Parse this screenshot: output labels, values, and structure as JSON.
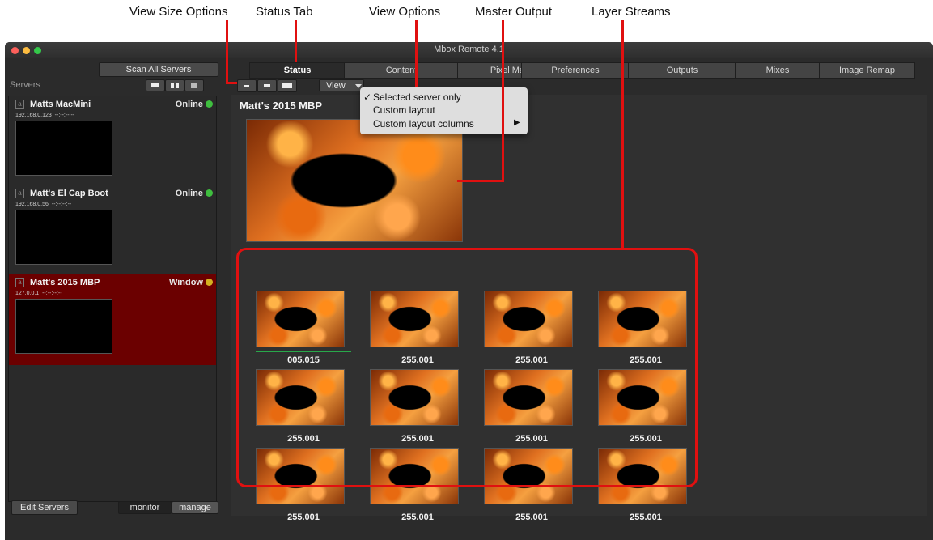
{
  "callouts": {
    "view_size": "View Size Options",
    "status_tab": "Status Tab",
    "view_options": "View Options",
    "master_output": "Master Output",
    "layer_streams": "Layer Streams"
  },
  "window": {
    "title": "Mbox Remote 4.1"
  },
  "toolbar": {
    "scan_all": "Scan All Servers",
    "servers_label": "Servers",
    "view_button": "View"
  },
  "tabs": [
    {
      "label": "Status",
      "active": true
    },
    {
      "label": "Content"
    },
    {
      "label": "Pixel Map"
    },
    {
      "label": "Preferences"
    },
    {
      "label": "Outputs"
    },
    {
      "label": "Mixes"
    },
    {
      "label": "Image Remap"
    }
  ],
  "servers": [
    {
      "name": "Matts MacMini",
      "ip": "192.168.0.123",
      "ip_extra": "--:--:--:--",
      "status": "Online",
      "status_color": "#3fbf3f"
    },
    {
      "name": "Matt's El Cap Boot",
      "ip": "192.168.0.56",
      "ip_extra": "--:--:--:--",
      "status": "Online",
      "status_color": "#3fbf3f"
    },
    {
      "name": "Matt's 2015 MBP",
      "ip": "127.0.0.1",
      "ip_extra": "--:--:--:--",
      "status": "Window",
      "status_color": "#d4b020",
      "selected": true
    }
  ],
  "view_menu": {
    "items": [
      "Selected server only",
      "Custom layout",
      "Custom layout columns"
    ],
    "checked": "Selected server only"
  },
  "master": {
    "title": "Matt's 2015 MBP"
  },
  "layers": {
    "labels": [
      "005.015",
      "255.001",
      "255.001",
      "255.001",
      "255.001",
      "255.001",
      "255.001",
      "255.001",
      "255.001",
      "255.001",
      "255.001",
      "255.001"
    ]
  },
  "footer": {
    "edit_servers": "Edit Servers",
    "monitor": "monitor",
    "manage": "manage"
  },
  "colors": {
    "callout_red": "#e01010",
    "selected_bg": "#6b0000"
  }
}
